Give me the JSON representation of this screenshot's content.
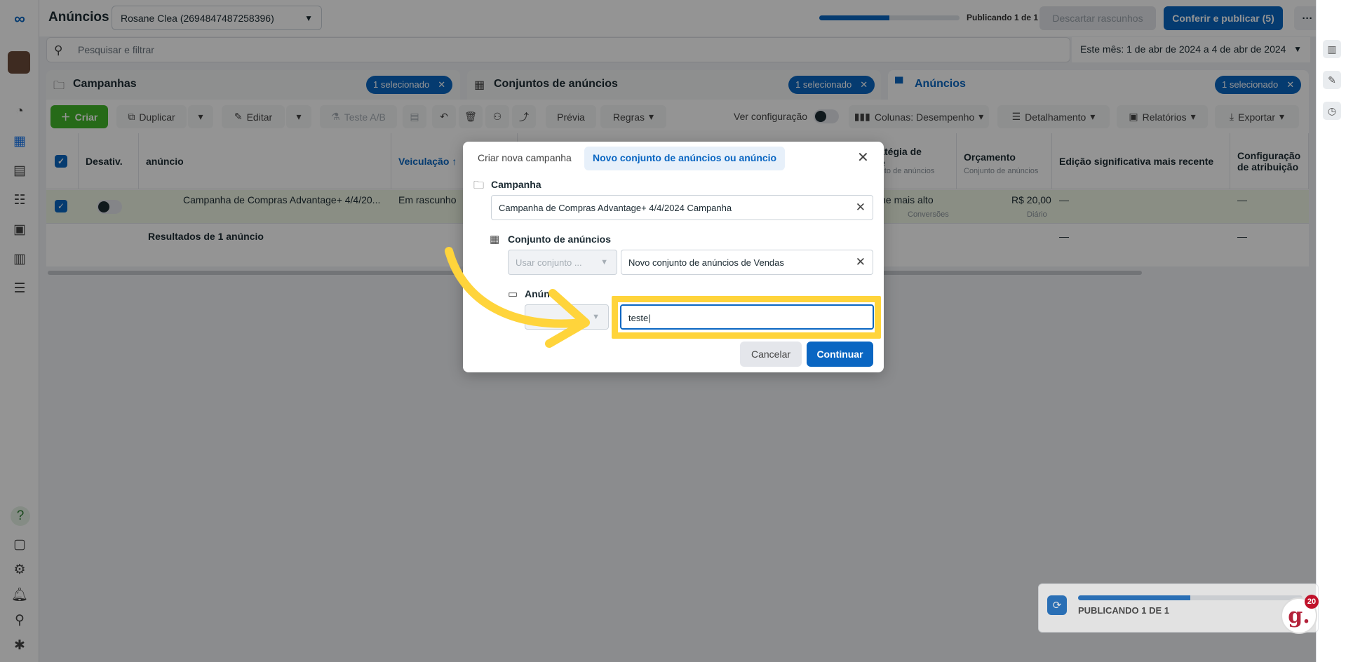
{
  "header": {
    "title": "Anúncios",
    "account": "Rosane Clea (2694847487258396)",
    "publishing_status": "Publicando 1 de 1",
    "publishing_progress": 0.5,
    "discard_label": "Descartar rascunhos",
    "review_publish_label": "Conferir e publicar (5)",
    "more_label": "···"
  },
  "search": {
    "placeholder": "Pesquisar e filtrar",
    "date_range": "Este mês: 1 de abr de 2024 a 4 de abr de 2024"
  },
  "level_tabs": [
    {
      "label": "Campanhas",
      "selected": "1 selecionado"
    },
    {
      "label": "Conjuntos de anúncios",
      "selected": "1 selecionado"
    },
    {
      "label": "Anúncios",
      "selected": "1 selecionado"
    }
  ],
  "toolbar": {
    "create": "Criar",
    "duplicate": "Duplicar",
    "edit": "Editar",
    "ab_test": "Teste A/B",
    "preview": "Prévia",
    "rules": "Regras",
    "view_config": "Ver configuração",
    "columns": "Colunas: Desempenho",
    "breakdown": "Detalhamento",
    "reports": "Relatórios",
    "export": "Exportar"
  },
  "table": {
    "headers": {
      "off_on": "Desativ.",
      "ad": "anúncio",
      "delivery": "Veiculação ↑",
      "bid_strategy": "Estratégia de lance",
      "bid_strategy_sub": "Conjunto de anúncios",
      "budget": "Orçamento",
      "budget_sub": "Conjunto de anúncios",
      "last_edit": "Edição significativa mais recente",
      "attribution": "Configuração de atribuição"
    },
    "row": {
      "name": "Campanha de Compras Advantage+ 4/4/20...",
      "delivery": "Em rascunho",
      "bid_strategy": "Volume mais alto",
      "bid_strategy_sub": "Conversões",
      "budget": "R$ 20,00",
      "budget_sub": "Diário",
      "last_edit": "—",
      "attribution": "—"
    },
    "results": {
      "label": "Resultados de 1 anúncio",
      "last_edit": "—",
      "attribution": "—"
    }
  },
  "modal": {
    "tab_new_campaign": "Criar nova campanha",
    "tab_new_adset": "Novo conjunto de anúncios ou anúncio",
    "campaign_label": "Campanha",
    "campaign_value": "Campanha de Compras Advantage+ 4/4/2024 Campanha",
    "adset_label": "Conjunto de anúncios",
    "adset_select": "Usar conjunto ...",
    "adset_value": "Novo conjunto de anúncios de Vendas",
    "ad_label": "Anún",
    "ad_value": "teste",
    "cancel": "Cancelar",
    "continue": "Continuar"
  },
  "publish_card": {
    "label": "PUBLICANDO 1 DE 1",
    "progress": 0.5
  },
  "badge": {
    "letter": "g.",
    "count": "20"
  },
  "colors": {
    "primary": "#0a66c2",
    "create_green": "#42b72a",
    "highlight": "#ffd43b"
  }
}
